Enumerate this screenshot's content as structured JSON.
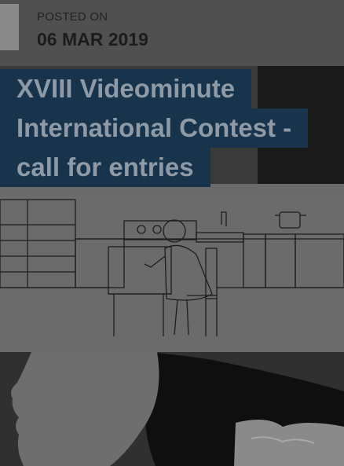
{
  "post": {
    "posted_label": "POSTED ON",
    "date": "06 MAR 2019",
    "title_lines": [
      "XVIII Videominute",
      "International Contest -",
      "call for entries"
    ]
  },
  "colors": {
    "page_bg": "#555555",
    "title_bg": "#17344c",
    "title_text": "#8e9aa6",
    "date_text": "#1c1c1c"
  },
  "images": [
    {
      "name": "kitchen-illustration",
      "description_icon": "drawing-icon"
    },
    {
      "name": "woman-photo",
      "description_icon": "photo-icon"
    }
  ]
}
